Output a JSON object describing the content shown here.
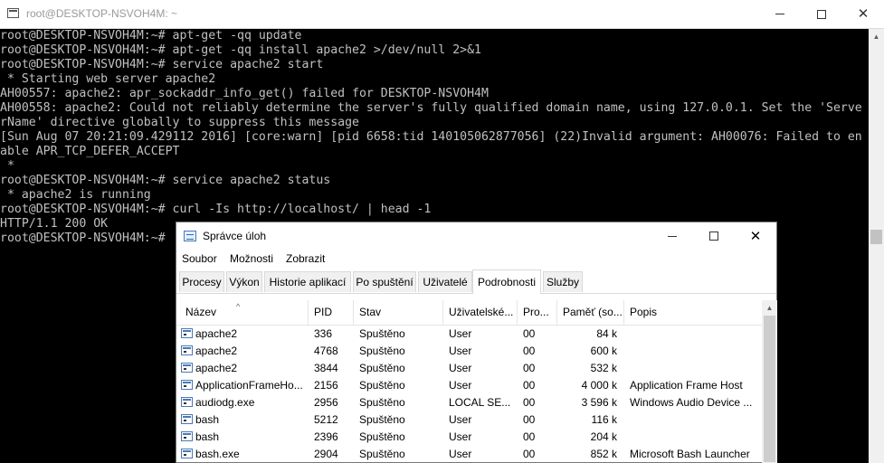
{
  "terminal": {
    "title": "root@DESKTOP-NSVOH4M: ~",
    "lines": [
      "root@DESKTOP-NSVOH4M:~# apt-get -qq update",
      "root@DESKTOP-NSVOH4M:~# apt-get -qq install apache2 >/dev/null 2>&1",
      "root@DESKTOP-NSVOH4M:~# service apache2 start",
      " * Starting web server apache2",
      "AH00557: apache2: apr_sockaddr_info_get() failed for DESKTOP-NSVOH4M",
      "AH00558: apache2: Could not reliably determine the server's fully qualified domain name, using 127.0.0.1. Set the 'Serve",
      "rName' directive globally to suppress this message",
      "[Sun Aug 07 20:21:09.429112 2016] [core:warn] [pid 6658:tid 140105062877056] (22)Invalid argument: AH00076: Failed to en",
      "able APR_TCP_DEFER_ACCEPT",
      " *",
      "root@DESKTOP-NSVOH4M:~# service apache2 status",
      " * apache2 is running",
      "root@DESKTOP-NSVOH4M:~# curl -Is http://localhost/ | head -1",
      "HTTP/1.1 200 OK",
      "root@DESKTOP-NSVOH4M:~#"
    ]
  },
  "task_manager": {
    "title": "Správce úloh",
    "menu": [
      "Soubor",
      "Možnosti",
      "Zobrazit"
    ],
    "tabs": [
      "Procesy",
      "Výkon",
      "Historie aplikací",
      "Po spuštění",
      "Uživatelé",
      "Podrobnosti",
      "Služby"
    ],
    "active_tab": "Podrobnosti",
    "columns": [
      "Název",
      "PID",
      "Stav",
      "Uživatelské...",
      "Pro...",
      "Paměť (so...",
      "Popis"
    ],
    "rows": [
      [
        "apache2",
        "336",
        "Spuštěno",
        "User",
        "00",
        "84 k",
        ""
      ],
      [
        "apache2",
        "4768",
        "Spuštěno",
        "User",
        "00",
        "600 k",
        ""
      ],
      [
        "apache2",
        "3844",
        "Spuštěno",
        "User",
        "00",
        "532 k",
        ""
      ],
      [
        "ApplicationFrameHo...",
        "2156",
        "Spuštěno",
        "User",
        "00",
        "4 000 k",
        "Application Frame Host"
      ],
      [
        "audiodg.exe",
        "2956",
        "Spuštěno",
        "LOCAL SE...",
        "00",
        "3 596 k",
        "Windows Audio Device ..."
      ],
      [
        "bash",
        "5212",
        "Spuštěno",
        "User",
        "00",
        "116 k",
        ""
      ],
      [
        "bash",
        "2396",
        "Spuštěno",
        "User",
        "00",
        "204 k",
        ""
      ],
      [
        "bash.exe",
        "2904",
        "Spuštěno",
        "User",
        "00",
        "852 k",
        "Microsoft Bash Launcher"
      ]
    ]
  }
}
